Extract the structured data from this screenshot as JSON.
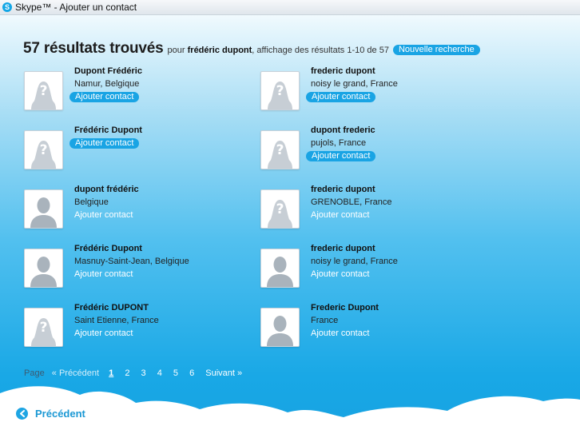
{
  "window": {
    "title": "Skype™ - Ajouter un contact",
    "logo_letter": "S"
  },
  "colors": {
    "accent": "#19a4e4",
    "header_text": "#1d1d1d",
    "back_link": "#1b98d4"
  },
  "header": {
    "count_text": "57 résultats trouvés",
    "pour": "pour",
    "query": "frédéric dupont",
    "display": ", affichage des résultats 1-10 de 57",
    "new_search": "Nouvelle recherche"
  },
  "results": [
    {
      "name": "Dupont Frédéric",
      "location": "Namur, Belgique",
      "avatar": "unknown-avatar-icon",
      "add_label": "Ajouter contact",
      "button_highlighted": true
    },
    {
      "name": "frederic dupont",
      "location": "noisy le grand, France",
      "avatar": "unknown-avatar-icon",
      "add_label": "Ajouter contact",
      "button_highlighted": true
    },
    {
      "name": "Frédéric Dupont",
      "location": "",
      "avatar": "unknown-avatar-icon",
      "add_label": "Ajouter contact",
      "button_highlighted": true
    },
    {
      "name": "dupont frederic",
      "location": "pujols, France",
      "avatar": "unknown-avatar-icon",
      "add_label": "Ajouter contact",
      "button_highlighted": true
    },
    {
      "name": "dupont frédéric",
      "location": "Belgique",
      "avatar": "person-avatar-icon",
      "add_label": "Ajouter contact",
      "button_highlighted": false
    },
    {
      "name": "frederic dupont",
      "location": "GRENOBLE, France",
      "avatar": "unknown-avatar-icon",
      "add_label": "Ajouter contact",
      "button_highlighted": false
    },
    {
      "name": "Frédéric Dupont",
      "location": "Masnuy-Saint-Jean, Belgique",
      "avatar": "person-avatar-icon",
      "add_label": "Ajouter contact",
      "button_highlighted": false
    },
    {
      "name": "frederic dupont",
      "location": "noisy le grand, France",
      "avatar": "person-avatar-icon",
      "add_label": "Ajouter contact",
      "button_highlighted": false
    },
    {
      "name": "Frédéric DUPONT",
      "location": "Saint Etienne, France",
      "avatar": "unknown-avatar-icon",
      "add_label": "Ajouter contact",
      "button_highlighted": false
    },
    {
      "name": "Frederic Dupont",
      "location": "France",
      "avatar": "person-avatar-icon",
      "add_label": "Ajouter contact",
      "button_highlighted": false
    }
  ],
  "pagination": {
    "label": "Page",
    "previous": "« Précédent",
    "pages": [
      "1",
      "2",
      "3",
      "4",
      "5",
      "6"
    ],
    "current": "1",
    "next": "Suivant »"
  },
  "footer": {
    "back_label": "Précédent",
    "back_icon": "chevron-left-icon"
  }
}
